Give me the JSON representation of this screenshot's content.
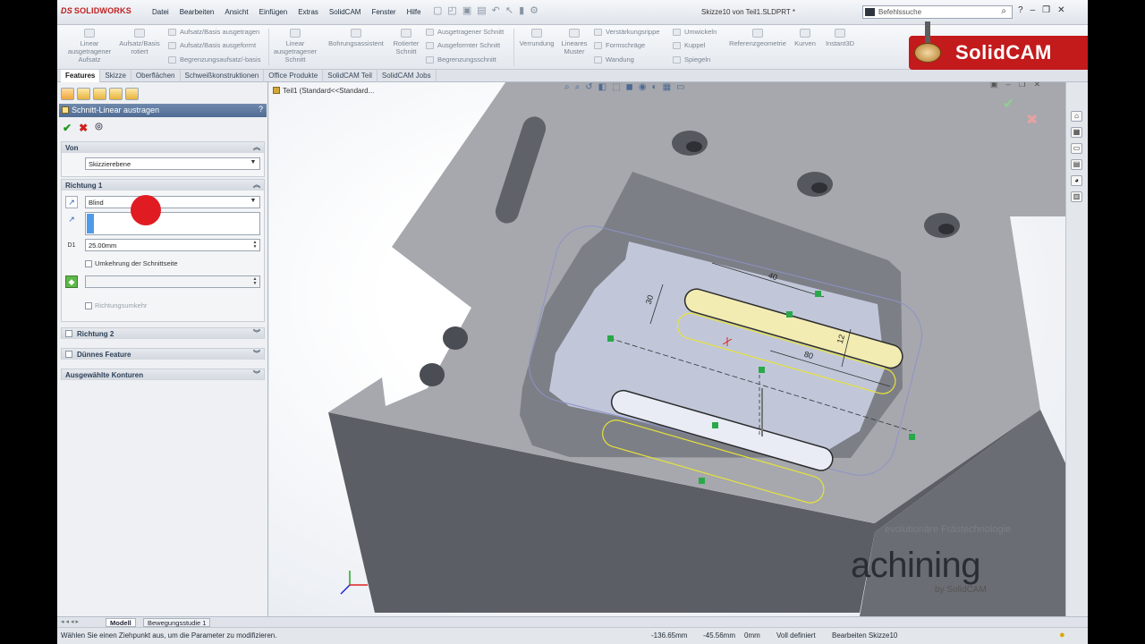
{
  "titlebar": {
    "app_logo": "SOLIDWORKS",
    "menu": [
      "Datei",
      "Bearbeiten",
      "Ansicht",
      "Einfügen",
      "Extras",
      "SolidCAM",
      "Fenster",
      "Hilfe"
    ],
    "doc_title": "Skizze10 von Teil1.SLDPRT *",
    "search_placeholder": "Befehlssuche"
  },
  "ribbon": {
    "linear_aufsatz": [
      "Linear",
      "ausgetragener",
      "Aufsatz"
    ],
    "aufsatz_rotiert": [
      "Aufsatz/Basis",
      "rotiert"
    ],
    "small_col1": [
      "Aufsatz/Basis ausgetragen",
      "Aufsatz/Basis ausgeformt",
      "Begrenzungsaufsatz/-basis"
    ],
    "linear_schnitt": [
      "Linear",
      "ausgetragener",
      "Schnitt"
    ],
    "bohrung": "Bohrungsassistent",
    "rotierter_schnitt": [
      "Rotierter",
      "Schnitt"
    ],
    "small_col2": [
      "Ausgetragener Schnitt",
      "Ausgeformter Schnitt",
      "Begrenzungsschnitt"
    ],
    "verrundung": "Verrundung",
    "lineares_muster": [
      "Lineares",
      "Muster"
    ],
    "small_col3": [
      "Verstärkungsrippe",
      "Formschräge",
      "Wandung"
    ],
    "small_col4": [
      "Umwickeln",
      "Kuppel",
      "Spiegeln"
    ],
    "referenzgeometrie": "Referenzgeometrie",
    "kurven": "Kurven",
    "instant3d": "Instant3D",
    "solidcam_brand": "SolidCAM"
  },
  "tabs": [
    "Features",
    "Skizze",
    "Oberflächen",
    "Schweißkonstruktionen",
    "Office Produkte",
    "SolidCAM Teil",
    "SolidCAM Jobs"
  ],
  "panel": {
    "title": "Schnitt-Linear austragen",
    "help": "?",
    "von": {
      "heading": "Von",
      "value": "Skizzierebene"
    },
    "richtung1": {
      "heading": "Richtung 1",
      "type_value": "Blind",
      "depth": "25.00mm",
      "flip_label": "Umkehrung der Schnittseite",
      "dir_reverse_label": "Richtungsumkehr",
      "depth_icon_label": "D1"
    },
    "richtung2": "Richtung 2",
    "duennes": "Dünnes Feature",
    "konturen": "Ausgewählte Konturen"
  },
  "viewport": {
    "tree_label": "Teil1  (Standard<<Standard...",
    "watermark_line": "evolutionäre Frästechnologie",
    "watermark_big": "achining",
    "watermark_by": "by SolidCAM",
    "dims": {
      "d40": "40",
      "d30": "30",
      "d12": "12",
      "d80": "80"
    }
  },
  "bottom_tabs": [
    "Modell",
    "Bewegungsstudie 1"
  ],
  "status": {
    "message": "Wählen Sie einen Ziehpunkt aus, um die Parameter zu modifizieren.",
    "x": "-136.65mm",
    "y": "-45.56mm",
    "z": "0mm",
    "definition": "Voll definiert",
    "editing": "Bearbeiten Skizze10"
  },
  "colors": {
    "solidcam_red": "#c31a1c",
    "panel_title": "#5a7399",
    "sketch_yellow": "#e6e23a",
    "part_gray": "#a4a6ac",
    "cursor_red": "#e11b22"
  }
}
